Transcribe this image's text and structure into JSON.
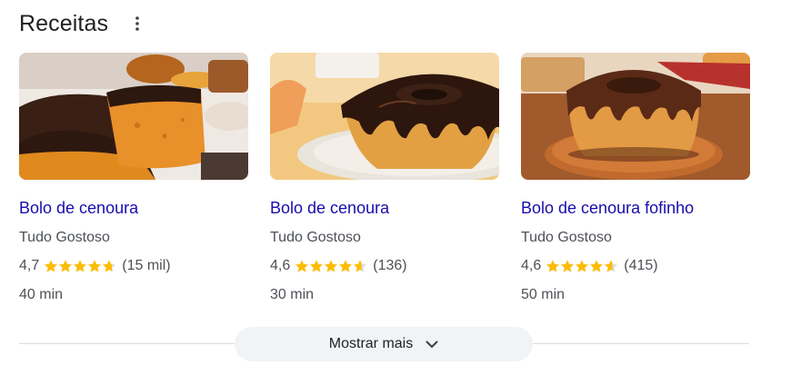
{
  "header": {
    "title": "Receitas",
    "more_icon": "more-vert-icon"
  },
  "colors": {
    "link": "#1a0dab",
    "star": "#fbbc04",
    "star_empty": "#dadce0",
    "meta": "#4d5156",
    "button_bg": "#f1f3f4"
  },
  "recipes": [
    {
      "image": "carrot-cake-sliced-photo",
      "title": "Bolo de cenoura",
      "source": "Tudo Gostoso",
      "rating": "4,7",
      "rating_value": 4.7,
      "reviews": "(15 mil)",
      "time": "40 min"
    },
    {
      "image": "carrot-cake-bundt-chocolate-photo",
      "title": "Bolo de cenoura",
      "source": "Tudo Gostoso",
      "rating": "4,6",
      "rating_value": 4.6,
      "reviews": "(136)",
      "time": "30 min"
    },
    {
      "image": "carrot-cake-fluffy-photo",
      "title": "Bolo de cenoura fofinho",
      "source": "Tudo Gostoso",
      "rating": "4,6",
      "rating_value": 4.6,
      "reviews": "(415)",
      "time": "50 min"
    }
  ],
  "footer": {
    "show_more_label": "Mostrar mais",
    "show_more_icon": "chevron-down-icon"
  }
}
